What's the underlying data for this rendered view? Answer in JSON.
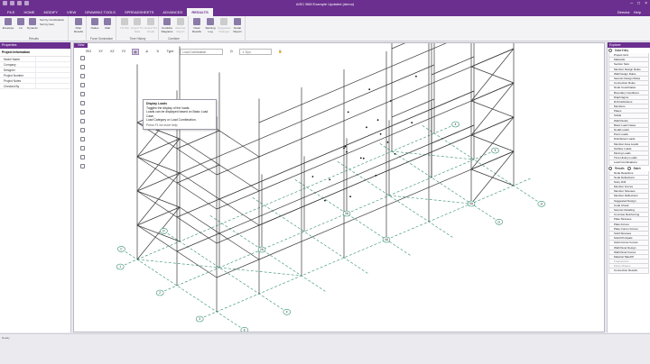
{
  "titlebar": {
    "document": "AISC BIM Example Updated (demo)"
  },
  "menu": {
    "tabs": [
      "FILE",
      "HOME",
      "MODIFY",
      "VIEW",
      "DRAWING TOOLS",
      "SPREADSHEETS",
      "ADVANCED",
      "RESULTS"
    ],
    "active": "RESULTS",
    "user": "Director",
    "help": "Help"
  },
  "ribbon": {
    "groups": {
      "results": "Results",
      "force_summation": "Force Summation",
      "time_history": "Time History",
      "combine": "Combine",
      "report": "Report"
    },
    "buttons": {
      "envelope": "Envelope",
      "lc": "LC",
      "dynamic": "Dynamic",
      "sort_combination": "Sort by Combination",
      "sort_item": "Sort by Item",
      "filter_results": "Filter Results",
      "nodes": "Nodes",
      "wall": "Wall",
      "th_plot": "TH Plot",
      "export_th": "Export TH Data",
      "export_graph": "Export TH Graph",
      "combine_diagrams": "Combine Diagrams",
      "member_report": "Member Report",
      "clear_results": "Clear Results",
      "warning_log": "Warning Log",
      "suggested_changes": "Suggested Changes",
      "detail_report": "Detail Report"
    }
  },
  "left_panel": {
    "header": "Properties",
    "section": "Project Information",
    "rows": [
      {
        "key": "Model Name",
        "value": ""
      },
      {
        "key": "Company",
        "value": ""
      },
      {
        "key": "Designer",
        "value": ""
      },
      {
        "key": "Project Number",
        "value": ""
      },
      {
        "key": "Project Notes",
        "value": ""
      },
      {
        "key": "Checked By",
        "value": ""
      }
    ]
  },
  "view": {
    "tab": "View",
    "toolbar": {
      "iso": "ISO",
      "xy": "XY",
      "xz": "XZ",
      "yz": "YZ",
      "type_label": "Type",
      "type_value": "Load Combination",
      "combo_value": "1: Dyn"
    },
    "tooltip": {
      "title": "Display Loads",
      "line1": "Toggles the display of the loads.",
      "line2": "Loads can be displayed based on Basic Load Case,",
      "line3": "Load Category or Load Combination.",
      "footer": "Press F1 for more help"
    },
    "grid_labels": [
      "C",
      "D",
      "E",
      "F",
      "1",
      "2",
      "3",
      "4",
      "5",
      "G",
      "H",
      "2A",
      "3A",
      "4A",
      "5A"
    ]
  },
  "explorer": {
    "header": "Explorer",
    "data_entry_label": "Data Entry",
    "data_entry": [
      "Project Grid",
      "Materials",
      "Section Sets",
      "Member Design Rules",
      "Wall Design Rules",
      "Seismic Design Rules",
      "Connection Rules",
      "Node Coordinates",
      "Boundary Conditions",
      "Diaphragms",
      "Drift Definitions",
      "Members",
      "Plates",
      "Solids",
      "Wall Panels",
      "Basic Load Cases",
      "Nodal Loads",
      "Point Loads",
      "Distributed Loads",
      "Member Area Loads",
      "Surface Loads",
      "Moving Loads",
      "Time History Loads",
      "Load Combinations"
    ],
    "results_label": "Results",
    "batch_label": "Batch",
    "results": [
      "Node Reactions",
      "Node Deflections",
      "Story Drift",
      "Member Forces",
      "Member Stresses",
      "Member Deflections",
      "Suggested Design",
      "Code Check",
      "Seismic Detailing",
      "Concrete Reinforcing",
      "Plate Stresses",
      "Plate Forces",
      "Plate Corner Forces",
      "Solid Stresses",
      "Solid Principals",
      "Solid Corner Forces",
      "Wall Panel Design",
      "Wall Panel Forces",
      "Material TakeOff",
      "Frequencies",
      "Mode Shapes",
      "Connection Results"
    ],
    "results_dim": [
      "Frequencies",
      "Mode Shapes"
    ]
  },
  "status": {
    "text": "Ready"
  },
  "colors": {
    "brand": "#6b2f8f",
    "frame": "#3a3a3a",
    "grid": "#2f8f6a"
  }
}
